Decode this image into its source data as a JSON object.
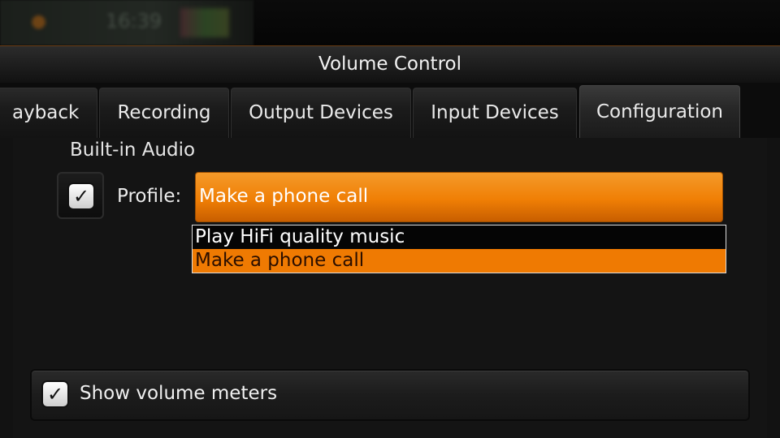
{
  "window": {
    "title": "Volume Control"
  },
  "status_bar": {
    "time": "16:39"
  },
  "tabs": [
    {
      "label": "ayback",
      "active": false
    },
    {
      "label": "Recording",
      "active": false
    },
    {
      "label": "Output Devices",
      "active": false
    },
    {
      "label": "Input Devices",
      "active": false
    },
    {
      "label": "Configuration",
      "active": true
    }
  ],
  "configuration": {
    "card_title": "Built-in Audio",
    "card_enabled": true,
    "profile_label": "Profile:",
    "profile_selected": "Make a phone call",
    "profile_options": [
      {
        "label": "Play HiFi quality music",
        "selected": false
      },
      {
        "label": "Make a phone call",
        "selected": true
      }
    ]
  },
  "footer": {
    "show_meters_label": "Show volume meters",
    "show_meters_checked": true
  },
  "colors": {
    "accent": "#f07f05",
    "background": "#121212"
  }
}
